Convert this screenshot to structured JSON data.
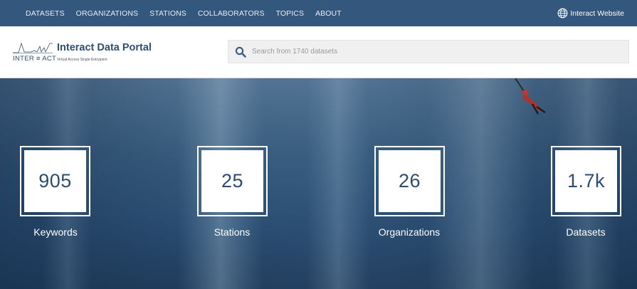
{
  "nav": {
    "items": [
      "DATASETS",
      "ORGANIZATIONS",
      "STATIONS",
      "COLLABORATORS",
      "TOPICS",
      "ABOUT"
    ],
    "external_link": "Interact Website"
  },
  "header": {
    "logo_brand": "INTER ≡ ACT",
    "title": "Interact Data Portal",
    "subtitle": "Virtual Access Single Entrypoint"
  },
  "search": {
    "placeholder": "Search from 1740 datasets"
  },
  "stats": [
    {
      "value": "905",
      "label": "Keywords"
    },
    {
      "value": "25",
      "label": "Stations"
    },
    {
      "value": "26",
      "label": "Organizations"
    },
    {
      "value": "1.7k",
      "label": "Datasets"
    }
  ],
  "colors": {
    "nav_bg": "#34577d",
    "brand": "#2f4f73"
  }
}
